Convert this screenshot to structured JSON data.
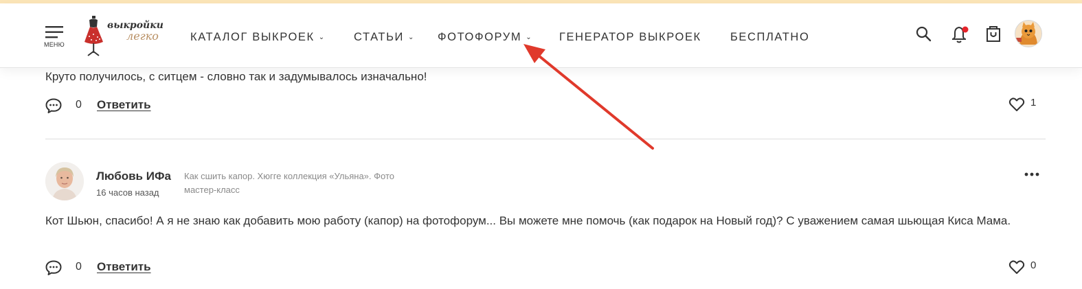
{
  "header": {
    "menu_label": "МЕНЮ",
    "logo_text_top": "выкройки",
    "logo_text_bottom": "легко",
    "nav": [
      {
        "label": "КАТАЛОГ ВЫКРОЕК",
        "has_dropdown": true
      },
      {
        "label": "СТАТЬИ",
        "has_dropdown": true
      },
      {
        "label": "ФОТОФОРУМ",
        "has_dropdown": true
      },
      {
        "label": "ГЕНЕРАТОР ВЫКРОЕК",
        "has_dropdown": false
      },
      {
        "label": "БЕСПЛАТНО",
        "has_dropdown": false
      }
    ],
    "dropdown_glyph": "⌄",
    "icons": [
      "search-icon",
      "bell-icon",
      "cart-icon",
      "avatar"
    ],
    "notification_dot_color": "#e5242b"
  },
  "comments": [
    {
      "text": "Круто получилось, с ситцем - словно так и задумывалось изначально!",
      "replies_count": "0",
      "reply_label": "Ответить",
      "likes": "1"
    },
    {
      "author": "Любовь ИФа",
      "time": "16 часов назад",
      "topic": "Как сшить капор. Хюгге коллекция «Ульяна». Фото мастер-класс",
      "text": "Кот Шьюн, спасибо! А я не знаю как добавить мою работу (капор) на фотофорум... Вы можете мне помочь (как подарок на Новый год)? С уважением самая шьющая Киса Мама.",
      "replies_count": "0",
      "reply_label": "Ответить",
      "likes": "0"
    }
  ],
  "colors": {
    "accent_top_bar": "#fbe4b7",
    "annotation_arrow": "#e0392b",
    "logo_dress": "#c9302c"
  }
}
